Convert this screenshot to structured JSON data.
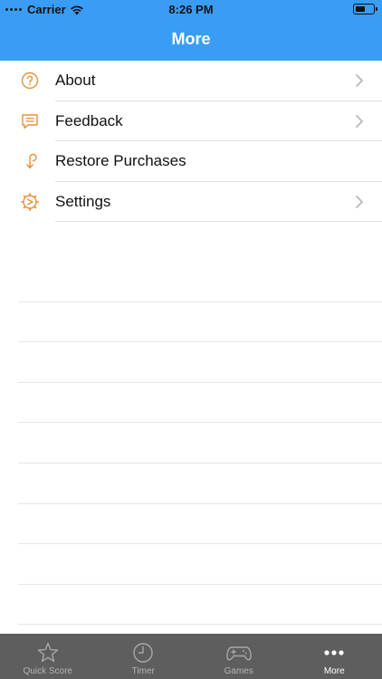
{
  "status_bar": {
    "carrier": "Carrier",
    "time": "8:26 PM"
  },
  "nav": {
    "title": "More"
  },
  "menu": {
    "items": [
      {
        "label": "About",
        "icon": "question-circle-icon",
        "chevron": true
      },
      {
        "label": "Feedback",
        "icon": "chat-bubble-icon",
        "chevron": true
      },
      {
        "label": "Restore Purchases",
        "icon": "restore-arrow-icon",
        "chevron": false
      },
      {
        "label": "Settings",
        "icon": "gear-icon",
        "chevron": true
      }
    ]
  },
  "tabbar": {
    "tabs": [
      {
        "label": "Quick Score",
        "icon": "star-icon",
        "active": false
      },
      {
        "label": "Timer",
        "icon": "clock-icon",
        "active": false
      },
      {
        "label": "Games",
        "icon": "gamepad-icon",
        "active": false
      },
      {
        "label": "More",
        "icon": "more-dots-icon",
        "active": true
      }
    ]
  },
  "colors": {
    "header": "#3a9df5",
    "accent_icon": "#e8903a",
    "tabbar_bg": "#5e5e5e"
  }
}
